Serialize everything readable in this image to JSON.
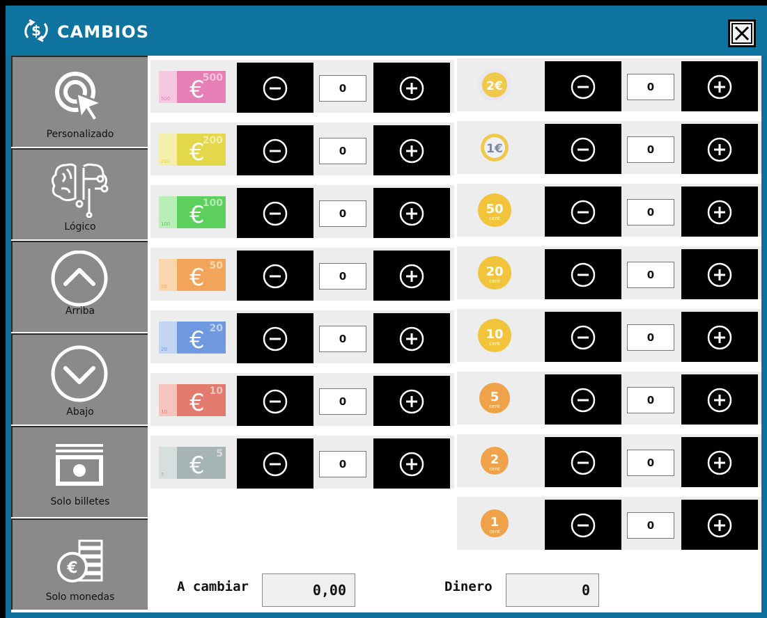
{
  "window": {
    "title": "CAMBIOS",
    "title_icon": "currency-exchange-icon",
    "close_icon": "close-icon"
  },
  "colors": {
    "titlebar": "#0f73a0",
    "sidebar": "#8a8a8a",
    "row": "#ededed",
    "button": "#000000"
  },
  "sidebar": {
    "items": [
      {
        "label": "Personalizado",
        "icon": "cursor-click-icon"
      },
      {
        "label": "Lógico",
        "icon": "brain-circuit-icon"
      },
      {
        "label": "Arriba",
        "icon": "chevron-up-icon"
      },
      {
        "label": "Abajo",
        "icon": "chevron-down-icon"
      },
      {
        "label": "Solo billetes",
        "icon": "banknotes-icon"
      },
      {
        "label": "Solo monedas",
        "icon": "euro-coins-icon"
      }
    ]
  },
  "bills": [
    {
      "value": "500",
      "qty": "0"
    },
    {
      "value": "200",
      "qty": "0"
    },
    {
      "value": "100",
      "qty": "0"
    },
    {
      "value": "50",
      "qty": "0"
    },
    {
      "value": "20",
      "qty": "0"
    },
    {
      "value": "10",
      "qty": "0"
    },
    {
      "value": "5",
      "qty": "0"
    }
  ],
  "coins": [
    {
      "value": "2€",
      "sub": "",
      "qty": "0"
    },
    {
      "value": "1€",
      "sub": "",
      "qty": "0"
    },
    {
      "value": "50",
      "sub": "cent",
      "qty": "0"
    },
    {
      "value": "20",
      "sub": "cent",
      "qty": "0"
    },
    {
      "value": "10",
      "sub": "cent",
      "qty": "0"
    },
    {
      "value": "5",
      "sub": "cent",
      "qty": "0"
    },
    {
      "value": "2",
      "sub": "cent",
      "qty": "0"
    },
    {
      "value": "1",
      "sub": "cent",
      "qty": "0"
    }
  ],
  "footer": {
    "a_cambiar_label": "A cambiar",
    "a_cambiar_value": "0,00",
    "dinero_label": "Dinero",
    "dinero_value": "0"
  }
}
